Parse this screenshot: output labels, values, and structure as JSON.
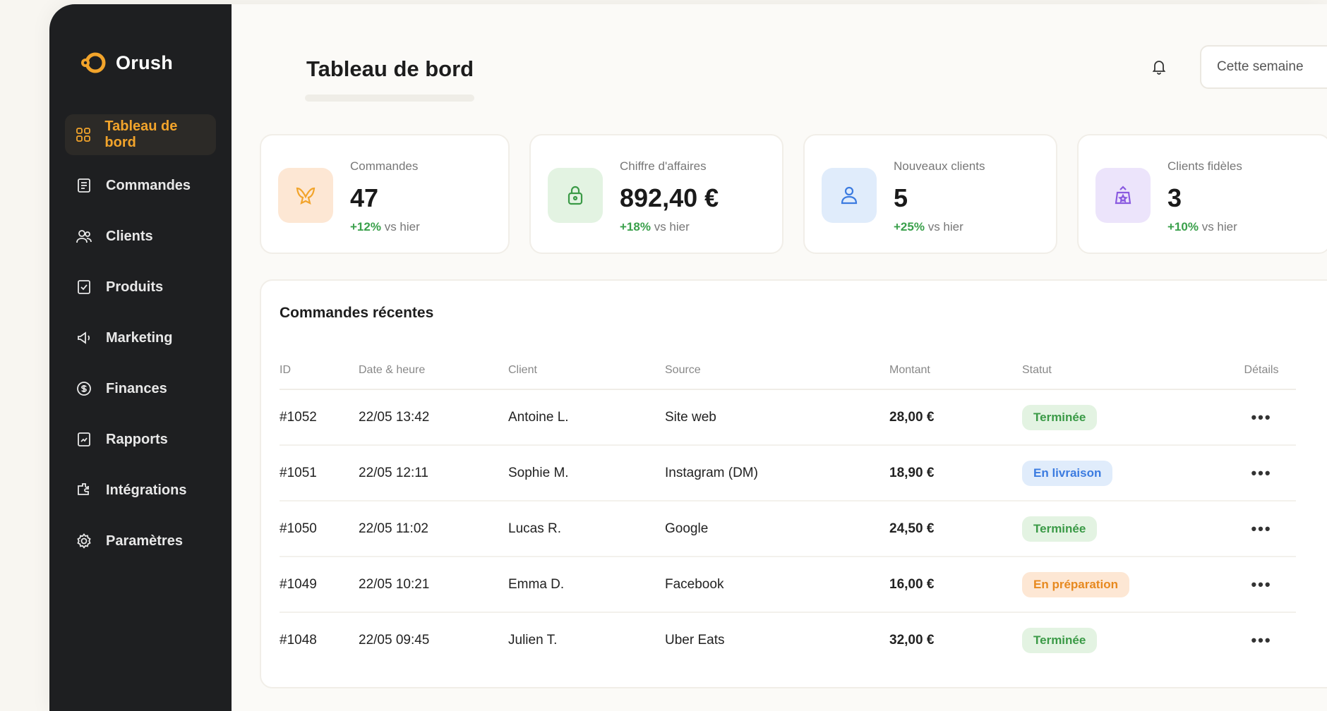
{
  "app": {
    "name": "Orush",
    "accent": "#f2a42b"
  },
  "sidebar": {
    "items": [
      {
        "label": "Tableau de bord",
        "icon": "dashboard-icon",
        "active": true
      },
      {
        "label": "Commandes",
        "icon": "orders-icon",
        "active": false
      },
      {
        "label": "Clients",
        "icon": "users-icon",
        "active": false
      },
      {
        "label": "Produits",
        "icon": "products-icon",
        "active": false
      },
      {
        "label": "Marketing",
        "icon": "megaphone-icon",
        "active": false
      },
      {
        "label": "Finances",
        "icon": "coin-icon",
        "active": false
      },
      {
        "label": "Rapports",
        "icon": "report-icon",
        "active": false
      },
      {
        "label": "Intégrations",
        "icon": "puzzle-icon",
        "active": false
      },
      {
        "label": "Paramètres",
        "icon": "gear-icon",
        "active": false
      }
    ]
  },
  "header": {
    "title": "Tableau de bord",
    "period": "Cette semaine",
    "bell_icon": "bell-icon"
  },
  "stats": [
    {
      "label": "Commandes",
      "value": "47",
      "trend_pct": "+12%",
      "trend_text": "vs hier",
      "icon": "bag-icon",
      "tint": "#fde7d4",
      "color": "#f2a42b"
    },
    {
      "label": "Chiffre d'affaires",
      "value": "892,40 €",
      "trend_pct": "+18%",
      "trend_text": "vs hier",
      "icon": "lock-bag-icon",
      "tint": "#e3f3e2",
      "color": "#3a9a46"
    },
    {
      "label": "Nouveaux clients",
      "value": "5",
      "trend_pct": "+25%",
      "trend_text": "vs hier",
      "icon": "user-icon",
      "tint": "#e0ecfb",
      "color": "#3b7be0"
    },
    {
      "label": "Clients fidèles",
      "value": "3",
      "trend_pct": "+10%",
      "trend_text": "vs hier",
      "icon": "loyal-bag-icon",
      "tint": "#ece4fb",
      "color": "#8a5ae0"
    }
  ],
  "orders": {
    "title": "Commandes récentes",
    "columns": [
      "ID",
      "Date & heure",
      "Client",
      "Source",
      "Montant",
      "Statut",
      "Détails"
    ],
    "rows": [
      {
        "id": "#1052",
        "date": "22/05 13:42",
        "client": "Antoine L.",
        "source": "Site web",
        "amount": "28,00 €",
        "status": "Terminée",
        "status_bg": "#e3f3e2",
        "status_color": "#3a9a46",
        "details": "•••"
      },
      {
        "id": "#1051",
        "date": "22/05 12:11",
        "client": "Sophie M.",
        "source": "Instagram (DM)",
        "amount": "18,90 €",
        "status": "En livraison",
        "status_bg": "#e0ecfb",
        "status_color": "#3b7be0",
        "details": "•••"
      },
      {
        "id": "#1050",
        "date": "22/05 11:02",
        "client": "Lucas R.",
        "source": "Google",
        "amount": "24,50 €",
        "status": "Terminée",
        "status_bg": "#e3f3e2",
        "status_color": "#3a9a46",
        "details": "•••"
      },
      {
        "id": "#1049",
        "date": "22/05 10:21",
        "client": "Emma D.",
        "source": "Facebook",
        "amount": "16,00 €",
        "status": "En préparation",
        "status_bg": "#fde7d4",
        "status_color": "#e7891f",
        "details": "•••"
      },
      {
        "id": "#1048",
        "date": "22/05 09:45",
        "client": "Julien T.",
        "source": "Uber Eats",
        "amount": "32,00 €",
        "status": "Terminée",
        "status_bg": "#e3f3e2",
        "status_color": "#3a9a46",
        "details": "•••"
      }
    ]
  }
}
